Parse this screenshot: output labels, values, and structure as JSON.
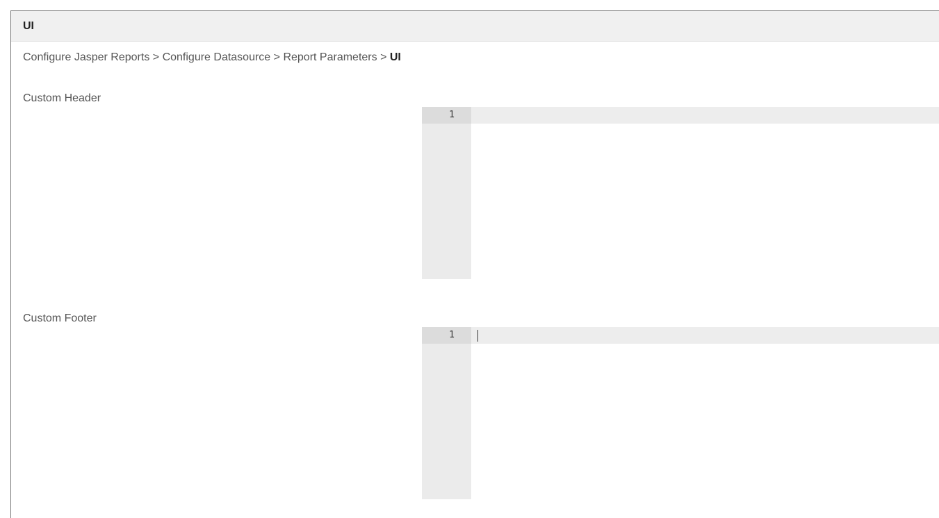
{
  "panel": {
    "title": "UI"
  },
  "breadcrumb": {
    "items": [
      "Configure Jasper Reports",
      "Configure Datasource",
      "Report Parameters"
    ],
    "separator": ">",
    "current": "UI"
  },
  "fields": {
    "header": {
      "label": "Custom Header",
      "line_number": "1",
      "value": ""
    },
    "footer": {
      "label": "Custom Footer",
      "line_number": "1",
      "value": ""
    }
  },
  "colors": {
    "header_bg": "#f0f0f0",
    "gutter_bg": "#ebebeb",
    "active_line_bg": "#ededed",
    "text": "#555555"
  }
}
